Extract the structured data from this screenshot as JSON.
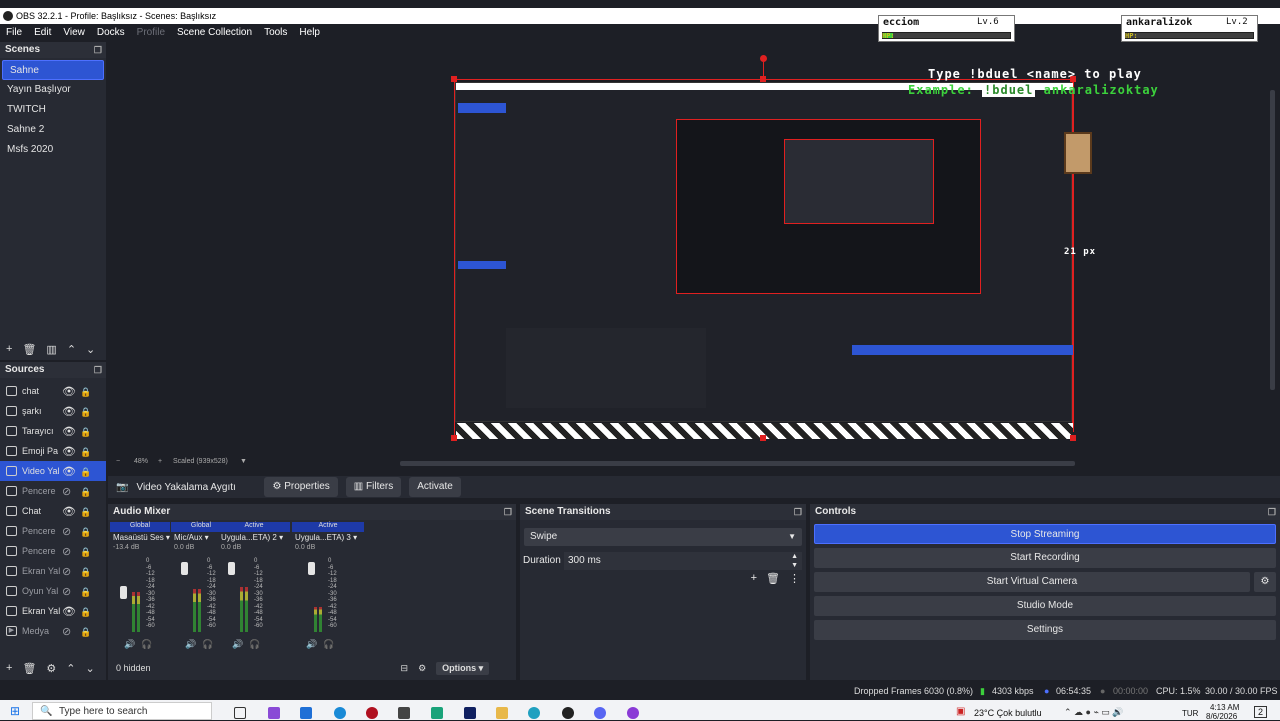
{
  "window": {
    "title": "OBS 32.2.1 - Profile: Başlıksız - Scenes: Başlıksız"
  },
  "menu": [
    "File",
    "Edit",
    "View",
    "Docks",
    "Profile",
    "Scene Collection",
    "Tools",
    "Help"
  ],
  "scenes": {
    "title": "Scenes",
    "items": [
      "Sahne",
      "Yayın Başlıyor",
      "TWITCH",
      "Sahne 2",
      "Msfs 2020"
    ],
    "selected": 0
  },
  "sources": {
    "title": "Sources",
    "items": [
      {
        "label": "chat",
        "dim": false
      },
      {
        "label": "şarkı",
        "dim": false
      },
      {
        "label": "Tarayıcı",
        "dim": false
      },
      {
        "label": "Emoji Pa",
        "dim": false
      },
      {
        "label": "Video Yal",
        "dim": false,
        "selected": true
      },
      {
        "label": "Pencere",
        "dim": true
      },
      {
        "label": "Chat",
        "dim": false
      },
      {
        "label": "Pencere",
        "dim": true
      },
      {
        "label": "Pencere",
        "dim": true
      },
      {
        "label": "Ekran Yal",
        "dim": true
      },
      {
        "label": "Oyun Yal",
        "dim": true
      },
      {
        "label": "Ekran Yal",
        "dim": false
      },
      {
        "label": "Medya",
        "dim": true
      }
    ]
  },
  "preview": {
    "zoom": "48%",
    "scaled": "Scaled (939x528)",
    "px_label": "21 px",
    "overlay_title": "Type !bduel <name> to play",
    "overlay_example_prefix": "Example:",
    "overlay_example_cmd": "!bduel",
    "overlay_example_name": "ankaralizoktay",
    "players": [
      {
        "name": "ecciom",
        "level": "Lv.6",
        "hp_label": "HP:",
        "hp": 0.08
      },
      {
        "name": "ankaralizok",
        "level": "Lv.2",
        "hp_label": "HP:",
        "hp": 0.0
      }
    ]
  },
  "source_bar": {
    "source_name": "Video Yakalama Aygıtı",
    "properties": "Properties",
    "filters": "Filters",
    "activate": "Activate"
  },
  "audio_mixer": {
    "title": "Audio Mixer",
    "channels": [
      {
        "tag": "Global",
        "name": "Masaüstü Ses",
        "db": "-13.4 dB"
      },
      {
        "tag": "Global",
        "name": "Mic/Aux",
        "db": "0.0 dB"
      },
      {
        "tag": "Active",
        "name": "Uygula...ETA) 2",
        "db": "0.0 dB"
      },
      {
        "tag": "Active",
        "name": "Uygula...ETA) 3",
        "db": "0.0 dB"
      }
    ],
    "ticks": [
      "0",
      "-6",
      "-12",
      "-18",
      "-24",
      "-30",
      "-36",
      "-42",
      "-48",
      "-54",
      "-60"
    ],
    "hidden": "0 hidden",
    "options": "Options"
  },
  "transitions": {
    "title": "Scene Transitions",
    "type": "Swipe",
    "duration_label": "Duration",
    "duration": "300 ms"
  },
  "controls": {
    "title": "Controls",
    "stop_streaming": "Stop Streaming",
    "start_recording": "Start Recording",
    "start_virtual_camera": "Start Virtual Camera",
    "studio_mode": "Studio Mode",
    "settings": "Settings"
  },
  "status": {
    "dropped": "Dropped Frames 6030 (0.8%)",
    "kbps": "4303 kbps",
    "stream_time": "06:54:35",
    "rec_time": "00:00:00",
    "cpu": "CPU: 1.5%",
    "fps": "30.00 / 30.00 FPS"
  },
  "taskbar": {
    "search_placeholder": "Type here to search",
    "weather": "23°C  Çok bulutlu",
    "lang": "TUR",
    "time": "4:13 AM",
    "date": "8/6/2026",
    "notif": "2"
  }
}
